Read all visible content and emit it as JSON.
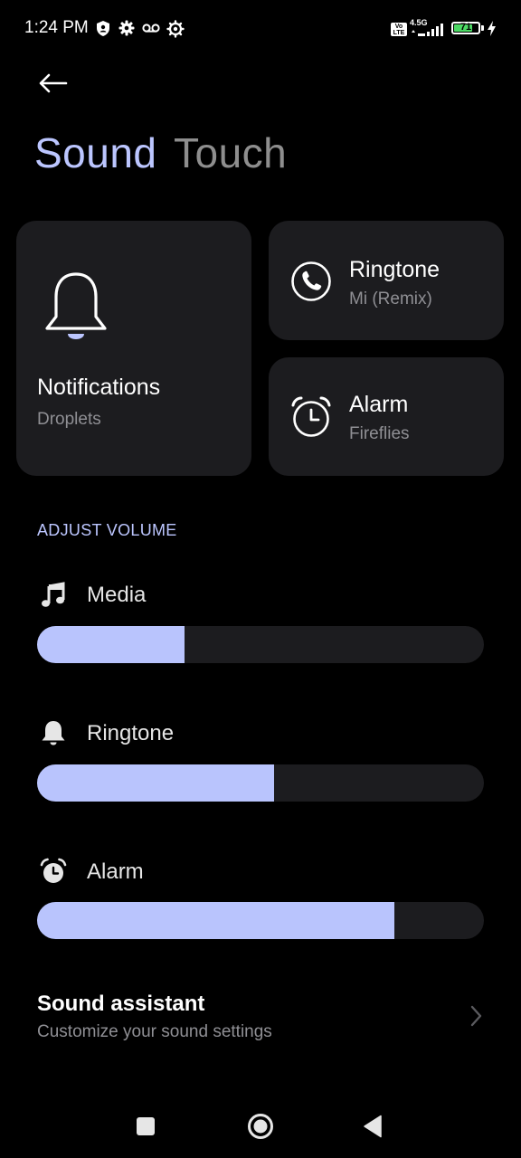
{
  "status_bar": {
    "time": "1:24 PM",
    "network_badge": "Vo LTE",
    "network_type": "4.5G",
    "battery_level": "71",
    "icons": [
      "shield-icon",
      "gear-icon",
      "voicemail-icon",
      "settings-cog-icon",
      "signal-icon",
      "battery-icon",
      "charging-icon"
    ]
  },
  "header": {
    "back_icon": "arrow-left-icon",
    "tabs": [
      {
        "label": "Sound",
        "active": true
      },
      {
        "label": "Touch",
        "active": false
      }
    ]
  },
  "cards": {
    "notifications": {
      "title": "Notifications",
      "subtitle": "Droplets",
      "icon": "bell-outline-icon"
    },
    "ringtone": {
      "title": "Ringtone",
      "subtitle": "Mi (Remix)",
      "icon": "phone-circle-icon"
    },
    "alarm": {
      "title": "Alarm",
      "subtitle": "Fireflies",
      "icon": "alarm-clock-icon"
    }
  },
  "adjust_volume": {
    "label": "ADJUST VOLUME",
    "sliders": [
      {
        "label": "Media",
        "icon": "music-note-icon",
        "level": 0.33
      },
      {
        "label": "Ringtone",
        "icon": "bell-icon",
        "level": 0.53
      },
      {
        "label": "Alarm",
        "icon": "alarm-icon",
        "level": 0.8
      }
    ]
  },
  "sound_assistant": {
    "title": "Sound assistant",
    "subtitle": "Customize your sound settings",
    "icon": "chevron-right-icon"
  },
  "nav_bar": {
    "icons": [
      "recents-square-icon",
      "home-circle-icon",
      "back-triangle-icon"
    ]
  },
  "colors": {
    "accent": "#bcc6ff",
    "slider_fill": "#b9c4fd",
    "card_bg": "#1c1c1f",
    "battery_green": "#4cd964"
  }
}
